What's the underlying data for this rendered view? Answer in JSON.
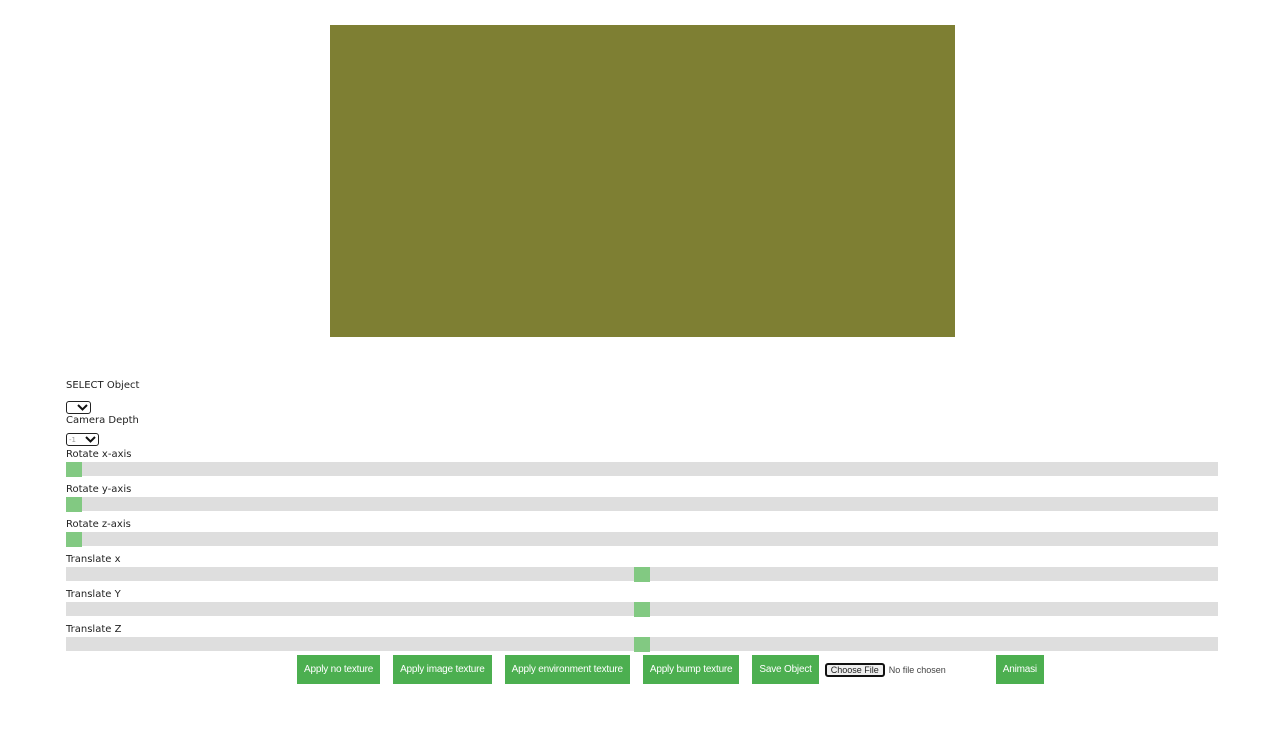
{
  "canvas": {
    "fill_color": "#7e7f33"
  },
  "controls": {
    "select_object": {
      "label": "SELECT Object",
      "value": ""
    },
    "camera_depth": {
      "label": "Camera Depth",
      "value": "-1"
    },
    "sliders": [
      {
        "label": "Rotate x-axis",
        "value_fraction": 0.0
      },
      {
        "label": "Rotate y-axis",
        "value_fraction": 0.0
      },
      {
        "label": "Rotate z-axis",
        "value_fraction": 0.0
      },
      {
        "label": "Translate x",
        "value_fraction": 0.5
      },
      {
        "label": "Translate Y",
        "value_fraction": 0.5
      },
      {
        "label": "Translate Z",
        "value_fraction": 0.5
      }
    ]
  },
  "buttons": {
    "no_texture": "Apply no texture",
    "image_texture": "Apply image texture",
    "environment_texture": "Apply environment texture",
    "bump_texture": "Apply bump texture",
    "save_object": "Save Object",
    "choose_file": "Choose File",
    "file_status": "No file chosen",
    "animasi": "Animasi"
  },
  "colors": {
    "button_bg": "#4caf50",
    "slider_track": "#dedede",
    "slider_thumb": "#82c982"
  }
}
